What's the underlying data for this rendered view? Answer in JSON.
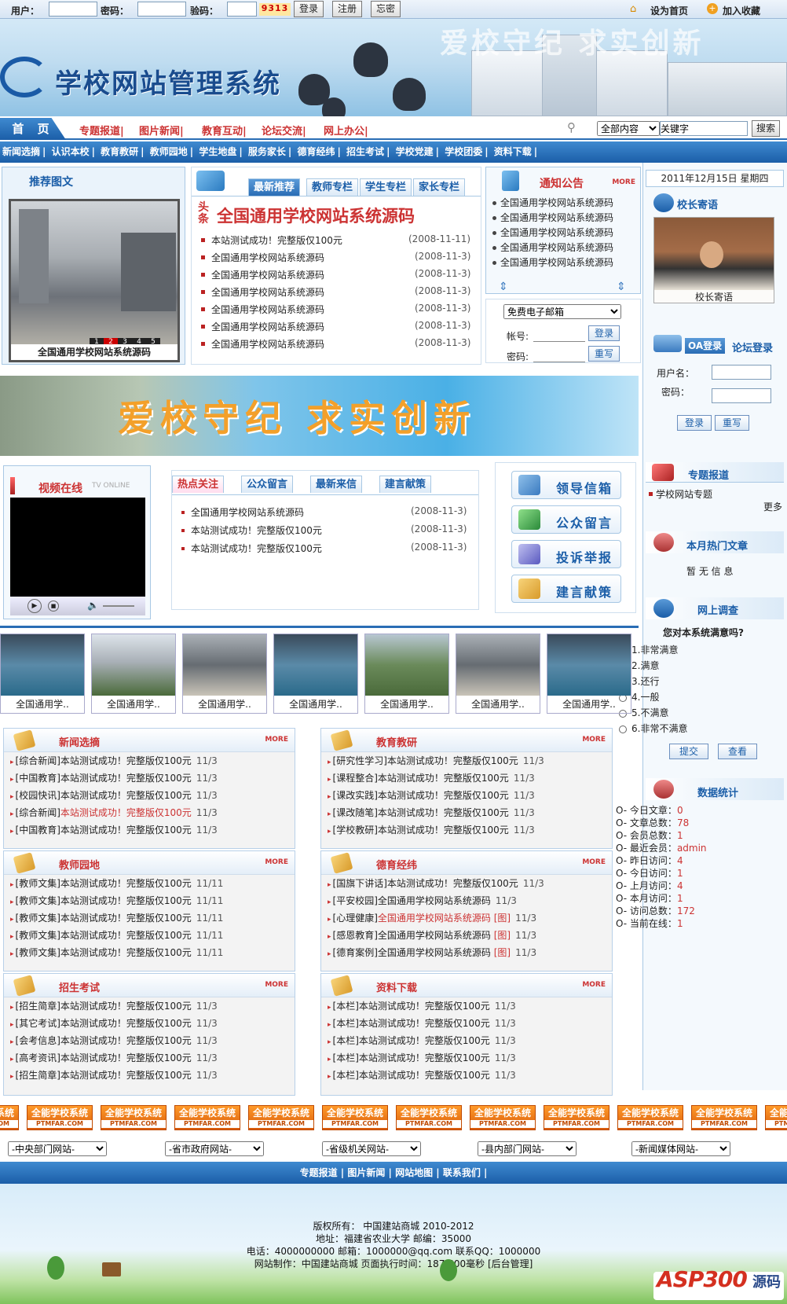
{
  "topbar": {
    "user_label": "用户：",
    "pass_label": "密码：",
    "code_label": "验码：",
    "captcha": "9313",
    "login": "登录",
    "register": "注册",
    "forgot": "忘密",
    "set_home": "设为首页",
    "add_fav": "加入收藏"
  },
  "banner": {
    "title": "学校网站管理系统",
    "slogan": "爱校守纪 求实创新"
  },
  "mainnav": {
    "home": "首 页",
    "links": [
      "专题报道|",
      "图片新闻|",
      "教育互动|",
      "论坛交流|",
      "网上办公|"
    ],
    "search_scope": "全部内容",
    "search_value": "关键字",
    "search_btn": "搜索"
  },
  "subnav": [
    "新闻选摘",
    "认识本校",
    "教育教研",
    "教师园地",
    "学生地盘",
    "服务家长",
    "德育经纬",
    "招生考试",
    "学校党建",
    "学校团委",
    "资料下载"
  ],
  "featured": {
    "title": "推荐图文",
    "caption": "全国通用学校网站系统源码",
    "pages": [
      "1",
      "2",
      "3",
      "4",
      "5"
    ]
  },
  "latest": {
    "tabs": [
      "最新推荐",
      "教师专栏",
      "学生专栏",
      "家长专栏"
    ],
    "headline_tag": "头条",
    "headline": "全国通用学校网站系统源码",
    "items": [
      {
        "t": "本站测试成功！完整版仅100元",
        "d": "(2008-11-11)"
      },
      {
        "t": "全国通用学校网站系统源码",
        "d": "(2008-11-3)"
      },
      {
        "t": "全国通用学校网站系统源码",
        "d": "(2008-11-3)"
      },
      {
        "t": "全国通用学校网站系统源码",
        "d": "(2008-11-3)"
      },
      {
        "t": "全国通用学校网站系统源码",
        "d": "(2008-11-3)"
      },
      {
        "t": "全国通用学校网站系统源码",
        "d": "(2008-11-3)"
      },
      {
        "t": "全国通用学校网站系统源码",
        "d": "(2008-11-3)"
      }
    ]
  },
  "notice": {
    "title": "通知公告",
    "more": "MORE",
    "items": [
      "全国通用学校网站系统源码",
      "全国通用学校网站系统源码",
      "全国通用学校网站系统源码",
      "全国通用学校网站系统源码",
      "全国通用学校网站系统源码",
      "全国通用学校网站系统源码"
    ]
  },
  "mail": {
    "select": "免费电子邮箱",
    "account": "帐号:",
    "password": "密码:",
    "login": "登录",
    "reset": "重写"
  },
  "date": "2011年12月15日 星期四",
  "principal": {
    "title": "校长寄语",
    "caption": "校长寄语"
  },
  "oa": {
    "tab1": "OA登录",
    "tab2": "论坛登录",
    "user": "用户名：",
    "pass": "密码：",
    "login": "登录",
    "reset": "重写"
  },
  "promo": {
    "text": "爱校守纪 求实创新"
  },
  "video": {
    "title": "视频在线",
    "subtitle": "TV ONLINE"
  },
  "hot": {
    "tabs": [
      "热点关注",
      "公众留言",
      "最新来信",
      "建言献策"
    ],
    "items": [
      {
        "t": "全国通用学校网站系统源码",
        "d": "(2008-11-3)"
      },
      {
        "t": "本站测试成功！完整版仅100元",
        "d": "(2008-11-3)"
      },
      {
        "t": "本站测试成功！完整版仅100元",
        "d": "(2008-11-3)"
      }
    ]
  },
  "quick": [
    "领导信箱",
    "公众留言",
    "投诉举报",
    "建言献策"
  ],
  "topic": {
    "title": "专题报道",
    "item": "学校网站专题",
    "more": "更多"
  },
  "hotmonth": {
    "title": "本月热门文章",
    "empty": "暂 无 信 息"
  },
  "survey": {
    "title": "网上调查",
    "question": "您对本系统满意吗?",
    "options": [
      "1.非常满意",
      "2.满意",
      "3.还行",
      "4.一般",
      "5.不满意",
      "6.非常不满意"
    ],
    "submit": "提交",
    "view": "查看"
  },
  "stats": {
    "title": "数据统计",
    "rows": [
      {
        "k": "O- 今日文章：",
        "v": "0"
      },
      {
        "k": "O- 文章总数：",
        "v": "78"
      },
      {
        "k": "O- 会员总数：",
        "v": "1"
      },
      {
        "k": "O- 最近会员：",
        "v": "admin"
      },
      {
        "k": "O- 昨日访问：",
        "v": "4"
      },
      {
        "k": "O- 今日访问：",
        "v": "1"
      },
      {
        "k": "O- 上月访问：",
        "v": "4"
      },
      {
        "k": "O- 本月访问：",
        "v": "1"
      },
      {
        "k": "O- 访问总数：",
        "v": "172"
      },
      {
        "k": "O- 当前在线：",
        "v": "1"
      }
    ]
  },
  "gallery": [
    "全国通用学..",
    "全国通用学..",
    "全国通用学..",
    "全国通用学..",
    "全国通用学..",
    "全国通用学..",
    "全国通用学.."
  ],
  "sections": [
    {
      "title": "新闻选摘",
      "items": [
        {
          "c": "[综合新闻]",
          "t": "本站测试成功！完整版仅100元",
          "d": "11/3"
        },
        {
          "c": "[中国教育]",
          "t": "本站测试成功！完整版仅100元",
          "d": "11/3"
        },
        {
          "c": "[校园快讯]",
          "t": "本站测试成功！完整版仅100元",
          "d": "11/3"
        },
        {
          "c": "[综合新闻]",
          "t": "本站测试成功！完整版仅100元",
          "d": "11/3",
          "red": true
        },
        {
          "c": "[中国教育]",
          "t": "本站测试成功！完整版仅100元",
          "d": "11/3"
        }
      ]
    },
    {
      "title": "教育教研",
      "items": [
        {
          "c": "[研究性学习]",
          "t": "本站测试成功！完整版仅100元",
          "d": "11/3"
        },
        {
          "c": "[课程整合]",
          "t": "本站测试成功！完整版仅100元",
          "d": "11/3"
        },
        {
          "c": "[课改实践]",
          "t": "本站测试成功！完整版仅100元",
          "d": "11/3"
        },
        {
          "c": "[课改随笔]",
          "t": "本站测试成功！完整版仅100元",
          "d": "11/3"
        },
        {
          "c": "[学校教研]",
          "t": "本站测试成功！完整版仅100元",
          "d": "11/3"
        }
      ]
    },
    {
      "title": "教师园地",
      "items": [
        {
          "c": "[教师文集]",
          "t": "本站测试成功！完整版仅100元",
          "d": "11/11"
        },
        {
          "c": "[教师文集]",
          "t": "本站测试成功！完整版仅100元",
          "d": "11/11"
        },
        {
          "c": "[教师文集]",
          "t": "本站测试成功！完整版仅100元",
          "d": "11/11"
        },
        {
          "c": "[教师文集]",
          "t": "本站测试成功！完整版仅100元",
          "d": "11/11"
        },
        {
          "c": "[教师文集]",
          "t": "本站测试成功！完整版仅100元",
          "d": "11/11"
        }
      ]
    },
    {
      "title": "德育经纬",
      "items": [
        {
          "c": "[国旗下讲话]",
          "t": "本站测试成功！完整版仅100元",
          "d": "11/3"
        },
        {
          "c": "[平安校园]",
          "t": "全国通用学校网站系统源码",
          "d": "11/3"
        },
        {
          "c": "[心理健康]",
          "t": "全国通用学校网站系统源码",
          "d": "11/3",
          "red": true,
          "pic": "[图]"
        },
        {
          "c": "[感恩教育]",
          "t": "全国通用学校网站系统源码",
          "d": "11/3",
          "pic": "[图]"
        },
        {
          "c": "[德育案例]",
          "t": "全国通用学校网站系统源码",
          "d": "11/3",
          "pic": "[图]"
        }
      ]
    },
    {
      "title": "招生考试",
      "items": [
        {
          "c": "[招生简章]",
          "t": "本站测试成功！完整版仅100元",
          "d": "11/3"
        },
        {
          "c": "[其它考试]",
          "t": "本站测试成功！完整版仅100元",
          "d": "11/3"
        },
        {
          "c": "[会考信息]",
          "t": "本站测试成功！完整版仅100元",
          "d": "11/3"
        },
        {
          "c": "[高考资讯]",
          "t": "本站测试成功！完整版仅100元",
          "d": "11/3"
        },
        {
          "c": "[招生简章]",
          "t": "本站测试成功！完整版仅100元",
          "d": "11/3"
        }
      ]
    },
    {
      "title": "资料下载",
      "items": [
        {
          "c": "[本栏]",
          "t": "本站测试成功！完整版仅100元",
          "d": "11/3"
        },
        {
          "c": "[本栏]",
          "t": "本站测试成功！完整版仅100元",
          "d": "11/3"
        },
        {
          "c": "[本栏]",
          "t": "本站测试成功！完整版仅100元",
          "d": "11/3"
        },
        {
          "c": "[本栏]",
          "t": "本站测试成功！完整版仅100元",
          "d": "11/3"
        },
        {
          "c": "[本栏]",
          "t": "本站测试成功！完整版仅100元",
          "d": "11/3"
        }
      ]
    }
  ],
  "more_label": "MORE",
  "ads": {
    "name": "全能学校系统",
    "sub": "PTMFAR.COM"
  },
  "dropdowns": [
    "-中央部门网站-",
    "-省市政府网站-",
    "-省级机关网站-",
    "-县内部门网站-",
    "-新闻媒体网站-"
  ],
  "footnav": "专题报道 | 图片新闻 | 网站地图 | 联系我们 |",
  "footer": [
    "版权所有： 中国建站商城 2010-2012",
    "地址：福建省农业大学 邮编：35000",
    "电话：4000000000 邮箱：1000000@qq.com 联系QQ：1000000",
    "网站制作：中国建站商城 页面执行时间：187.500毫秒 [后台管理]"
  ],
  "asp_logo": "ASP300",
  "asp_sub": "源码"
}
